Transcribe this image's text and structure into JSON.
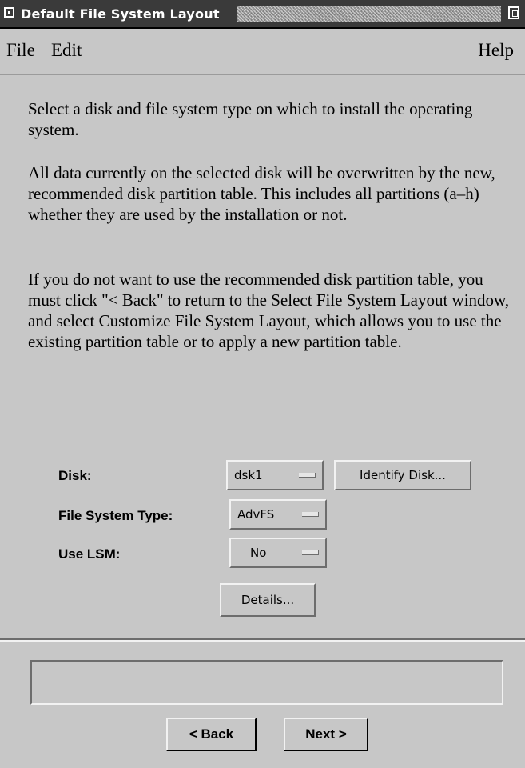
{
  "window": {
    "title": "Default File System Layout"
  },
  "menubar": {
    "file": "File",
    "edit": "Edit",
    "help": "Help"
  },
  "instructions": [
    "Select a disk and file system type on which to install the operating system.",
    "All data currently on the selected disk will be overwritten by the new, recommended disk partition table.  This includes all partitions (a–h) whether they are used by the installation or not.",
    "If you do not want to use the recommended disk partition table, you must click \"< Back\" to return to the Select File System Layout window, and select Customize File System Layout, which allows you to use the existing partition table or to apply a new partition table."
  ],
  "form": {
    "disk_label": "Disk:",
    "disk_value": "dsk1",
    "identify_button": "Identify Disk...",
    "fs_type_label": "File System Type:",
    "fs_type_value": "AdvFS",
    "lsm_label": "Use LSM:",
    "lsm_value": "No",
    "details_button": "Details..."
  },
  "status": {
    "message": ""
  },
  "nav": {
    "back": "< Back",
    "next": "Next >"
  }
}
